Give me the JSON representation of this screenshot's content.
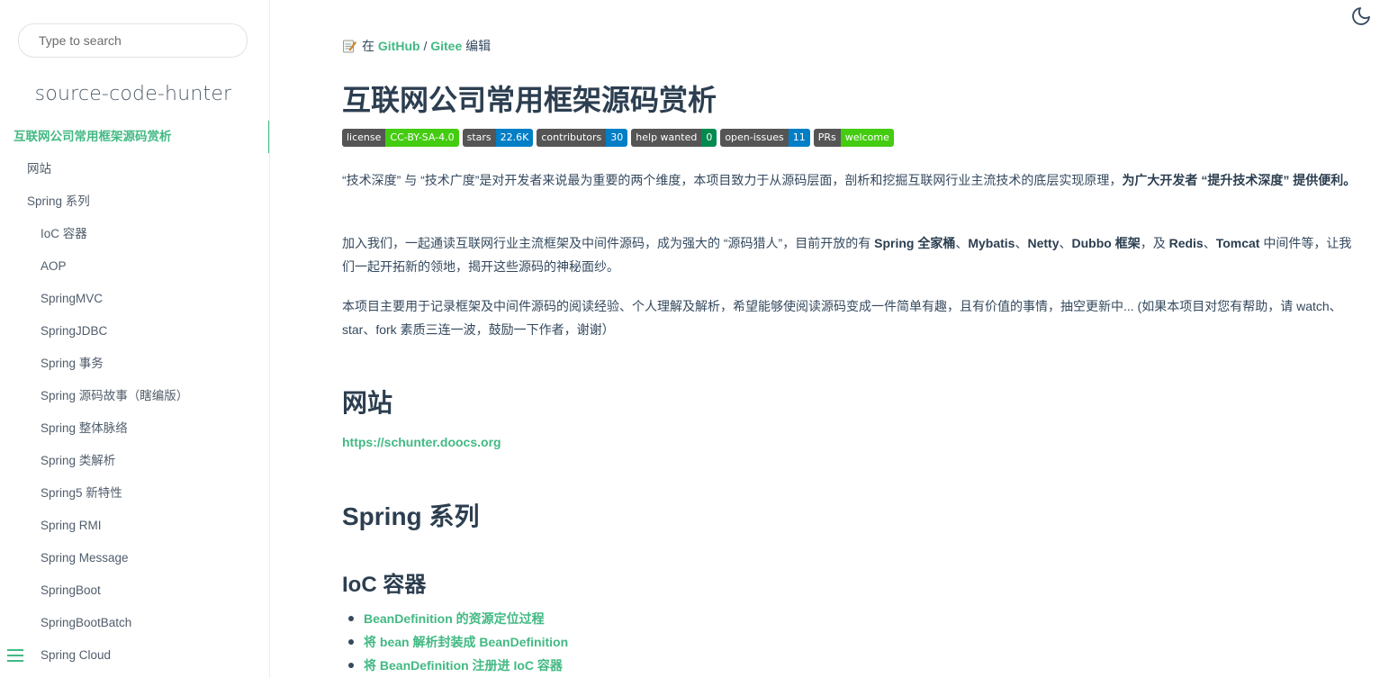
{
  "search": {
    "placeholder": "Type to search"
  },
  "app_name": "source-code-hunter",
  "sidebar": {
    "items": [
      {
        "label": "互联网公司常用框架源码赏析",
        "level": 0,
        "active": true
      },
      {
        "label": "网站",
        "level": 1
      },
      {
        "label": "Spring 系列",
        "level": 1
      },
      {
        "label": "IoC 容器",
        "level": 2
      },
      {
        "label": "AOP",
        "level": 2
      },
      {
        "label": "SpringMVC",
        "level": 2
      },
      {
        "label": "SpringJDBC",
        "level": 2
      },
      {
        "label": "Spring 事务",
        "level": 2
      },
      {
        "label": "Spring 源码故事（瞎编版）",
        "level": 2
      },
      {
        "label": "Spring 整体脉络",
        "level": 2
      },
      {
        "label": "Spring 类解析",
        "level": 2
      },
      {
        "label": "Spring5 新特性",
        "level": 2
      },
      {
        "label": "Spring RMI",
        "level": 2
      },
      {
        "label": "Spring Message",
        "level": 2
      },
      {
        "label": "SpringBoot",
        "level": 2
      },
      {
        "label": "SpringBootBatch",
        "level": 2
      },
      {
        "label": "Spring Cloud",
        "level": 2
      }
    ]
  },
  "edit": {
    "prefix": "在",
    "github": "GitHub",
    "sep": "/",
    "gitee": "Gitee",
    "suffix": "编辑"
  },
  "title": "互联网公司常用框架源码赏析",
  "badges": [
    {
      "key": "license",
      "value": "CC-BY-SA-4.0",
      "color": "#4c1"
    },
    {
      "key": "stars",
      "value": "22.6K",
      "color": "#007ec6"
    },
    {
      "key": "contributors",
      "value": "30",
      "color": "#007ec6"
    },
    {
      "key": "help wanted",
      "value": "0",
      "color": "#008a4e"
    },
    {
      "key": "open-issues",
      "value": "11",
      "color": "#007ec6"
    },
    {
      "key": "PRs",
      "value": "welcome",
      "color": "#4c1"
    }
  ],
  "para1": {
    "text": "“技术深度” 与 “技术广度”是对开发者来说最为重要的两个维度，本项目致力于从源码层面，剖析和挖掘互联网行业主流技术的底层实现原理，",
    "bold": "为广大开发者 “提升技术深度” 提供便利。"
  },
  "para2": {
    "t1": "加入我们，一起通读互联网行业主流框架及中间件源码，成为强大的 “源码猎人”，目前开放的有 ",
    "b1": "Spring 全家桶",
    "t2": "、",
    "b2": "Mybatis",
    "t3": "、",
    "b3": "Netty",
    "t4": "、",
    "b4": "Dubbo 框架",
    "t5": "，及 ",
    "b5": "Redis",
    "t6": "、",
    "b6": "Tomcat",
    "t7": " 中间件等，让我们一起开拓新的领地，揭开这些源码的神秘面纱。"
  },
  "para3": "本项目主要用于记录框架及中间件源码的阅读经验、个人理解及解析，希望能够使阅读源码变成一件简单有趣，且有价值的事情，抽空更新中... (如果本项目对您有帮助，请 watch、star、fork 素质三连一波，鼓励一下作者，谢谢）",
  "section_site": "网站",
  "site_url": "https://schunter.doocs.org",
  "section_spring": "Spring 系列",
  "section_ioc": "IoC 容器",
  "ioc_links": [
    "BeanDefinition 的资源定位过程",
    "将 bean 解析封装成 BeanDefinition",
    "将 BeanDefinition 注册进 IoC 容器"
  ],
  "icons": {
    "theme": "moon-icon",
    "menu": "hamburger-menu-icon",
    "edit": "memo-icon"
  },
  "colors": {
    "accent": "#42b983",
    "text": "#34495e",
    "heading": "#2c3e50"
  }
}
